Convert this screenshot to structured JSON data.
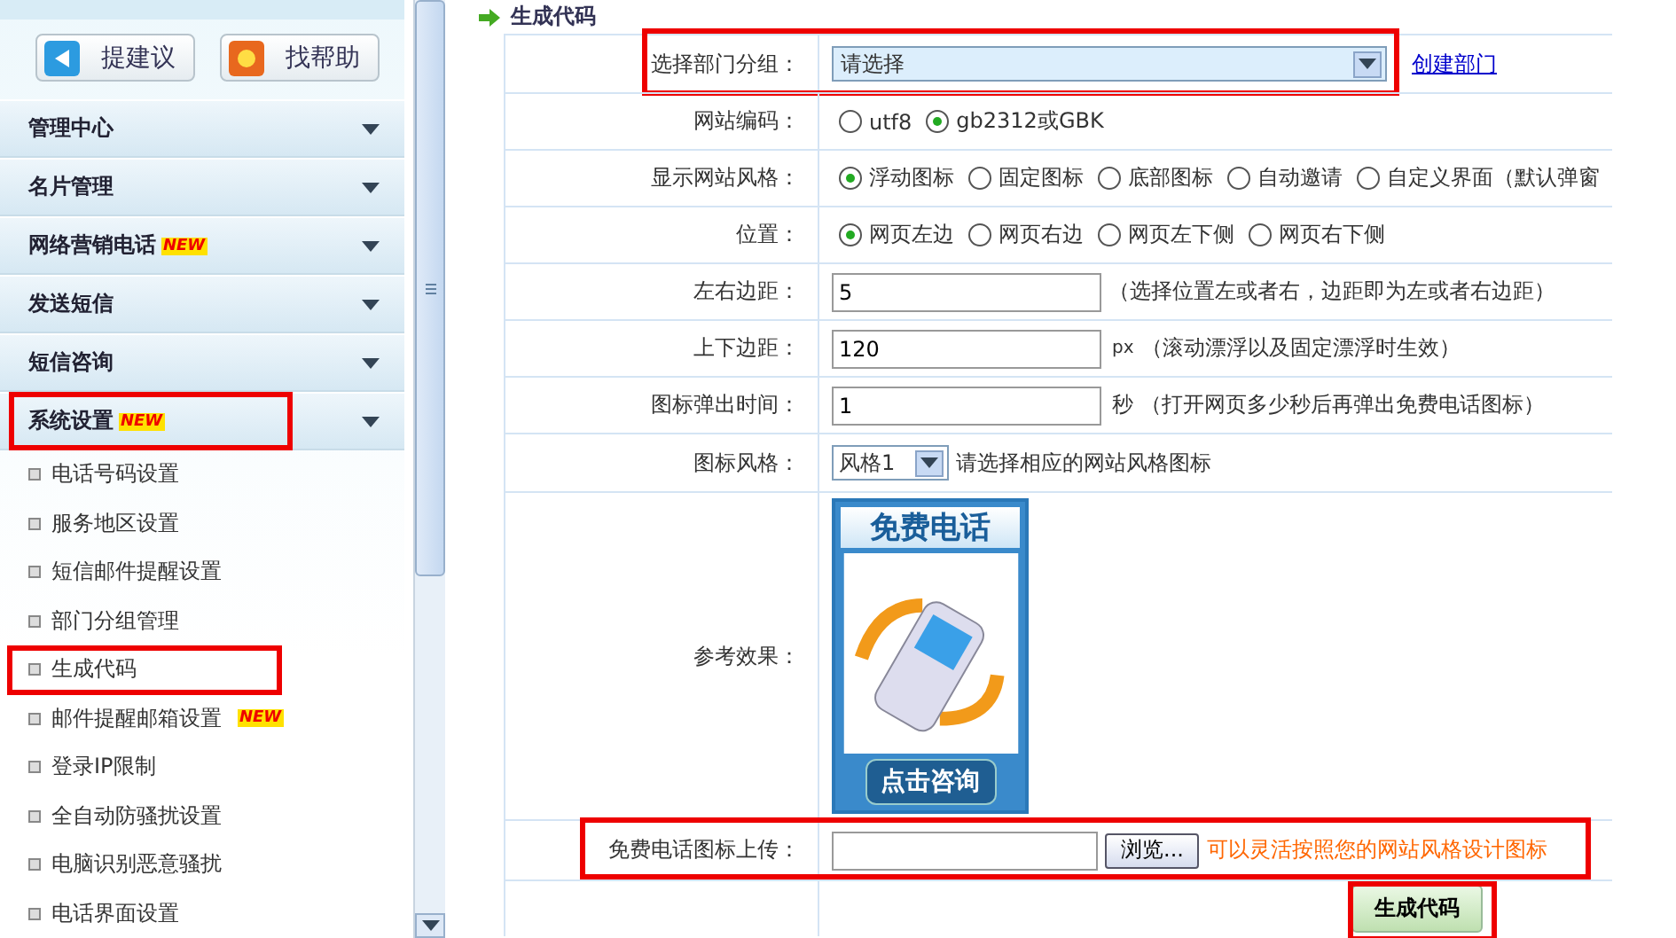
{
  "sidebar": {
    "top_buttons": [
      {
        "label": "提建议",
        "kind": "suggest"
      },
      {
        "label": "找帮助",
        "kind": "help"
      }
    ],
    "menu": [
      {
        "label": "管理中心",
        "highlighted": false
      },
      {
        "label": "名片管理",
        "highlighted": false
      },
      {
        "label": "网络营销电话",
        "badge": "NEW",
        "highlighted": false
      },
      {
        "label": "发送短信",
        "highlighted": false
      },
      {
        "label": "短信咨询",
        "highlighted": false
      },
      {
        "label": "系统设置",
        "badge": "NEW",
        "highlighted": true
      }
    ],
    "subitems": [
      {
        "label": "电话号码设置",
        "highlighted": false
      },
      {
        "label": "服务地区设置",
        "highlighted": false
      },
      {
        "label": "短信邮件提醒设置",
        "highlighted": false
      },
      {
        "label": "部门分组管理",
        "highlighted": false
      },
      {
        "label": "生成代码",
        "highlighted": true
      },
      {
        "label": "邮件提醒邮箱设置",
        "badge": "NEW",
        "highlighted": false
      },
      {
        "label": "登录IP限制",
        "highlighted": false
      },
      {
        "label": "全自动防骚扰设置",
        "highlighted": false
      },
      {
        "label": "电脑识别恶意骚扰",
        "highlighted": false
      },
      {
        "label": "电话界面设置",
        "highlighted": false
      }
    ]
  },
  "main": {
    "title": "生成代码",
    "rows": [
      {
        "kind": "select",
        "label": "选择部门分组：",
        "value": "请选择",
        "link": "创建部门",
        "highlighted": true
      },
      {
        "kind": "radio",
        "label": "网站编码：",
        "options": [
          {
            "label": "utf8",
            "selected": false
          },
          {
            "label": "gb2312或GBK",
            "selected": true
          }
        ],
        "highlighted": false
      },
      {
        "kind": "radio",
        "label": "显示网站风格：",
        "options": [
          {
            "label": "浮动图标",
            "selected": true
          },
          {
            "label": "固定图标",
            "selected": false
          },
          {
            "label": "底部图标",
            "selected": false
          },
          {
            "label": "自动邀请",
            "selected": false
          },
          {
            "label": "自定义界面（默认弹窗",
            "selected": false
          }
        ],
        "highlighted": false
      },
      {
        "kind": "radio",
        "label": "位置：",
        "options": [
          {
            "label": "网页左边",
            "selected": true
          },
          {
            "label": "网页右边",
            "selected": false
          },
          {
            "label": "网页左下侧",
            "selected": false
          },
          {
            "label": "网页右下侧",
            "selected": false
          }
        ],
        "highlighted": false
      },
      {
        "kind": "text",
        "label": "左右边距：",
        "value": "5",
        "note": "（选择位置左或者右，边距即为左或者右边距）",
        "highlighted": false
      },
      {
        "kind": "text",
        "label": "上下边距：",
        "value": "120",
        "unit": "px",
        "note": "（滚动漂浮以及固定漂浮时生效）",
        "highlighted": false
      },
      {
        "kind": "text",
        "label": "图标弹出时间：",
        "value": "1",
        "unit": "秒",
        "note": "（打开网页多少秒后再弹出免费电话图标）",
        "highlighted": false
      },
      {
        "kind": "dropdown",
        "label": "图标风格：",
        "value": "风格1",
        "note": "请选择相应的网站风格图标",
        "highlighted": false
      },
      {
        "kind": "preview",
        "label": "参考效果：",
        "title": "免费电话",
        "button": "点击咨询",
        "highlighted": false
      },
      {
        "kind": "upload",
        "label": "免费电话图标上传：",
        "button": "浏览...",
        "note": "可以灵活按照您的网站风格设计图标",
        "highlighted": true
      }
    ],
    "submit": {
      "label": "生成代码",
      "highlighted": true
    }
  }
}
